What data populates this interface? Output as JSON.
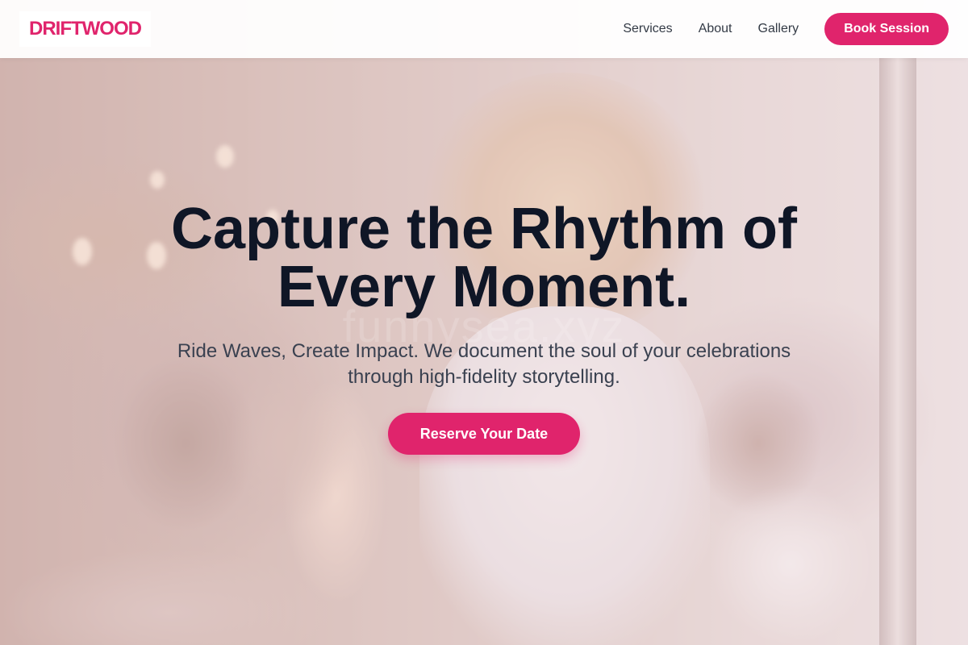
{
  "brand": {
    "logo": "DRIFTWOOD",
    "accent_color": "#e0246c"
  },
  "nav": {
    "links": [
      "Services",
      "About",
      "Gallery"
    ],
    "cta": "Book Session"
  },
  "hero": {
    "title": "Capture the Rhythm of Every Moment.",
    "subtitle": "Ride Waves, Create Impact. We document the soul of your celebrations through high-fidelity storytelling.",
    "cta": "Reserve Your Date",
    "watermark": "funnysea.xyz",
    "background": "blurred-celebration-photo"
  },
  "colors": {
    "title": "#0f1626",
    "subtitle": "#3a4150",
    "nav_text": "#333a45"
  }
}
